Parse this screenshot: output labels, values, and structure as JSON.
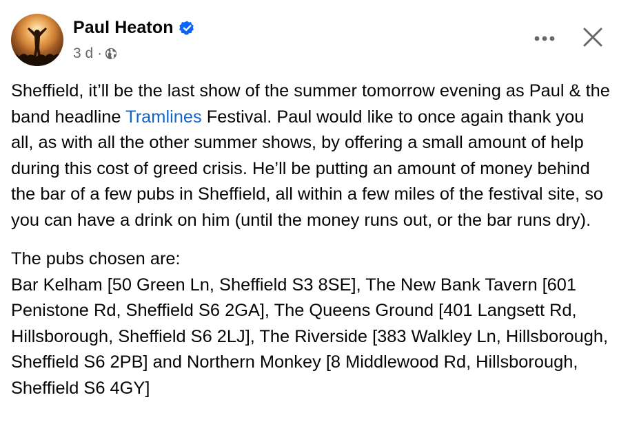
{
  "post": {
    "author": {
      "name": "Paul Heaton",
      "verified": true,
      "avatar_icon": "concert-photo-avatar"
    },
    "timestamp": "3 d",
    "separator": "·",
    "audience_icon": "globe-icon",
    "paragraph1": {
      "before_link": "Sheffield, it’ll be the last show of the summer tomorrow evening as Paul & the band headline ",
      "link": "Tramlines",
      "after_link": " Festival. Paul would like to once again thank you all, as with all the other summer shows, by offering a small amount of help during this cost of greed crisis. He’ll be putting an amount of money behind the bar of a few pubs in Sheffield, all within a few miles of the festival site, so you can have a drink on him (until the money runs out, or the bar runs dry)."
    },
    "paragraph2": {
      "heading": "The pubs chosen are:",
      "text": "Bar Kelham [50 Green Ln, Sheffield S3 8SE], The New Bank Tavern [601 Penistone Rd, Sheffield S6 2GA], The Queens Ground [401 Langsett Rd, Hillsborough, Sheffield S6 2LJ], The Riverside [383 Walkley Ln, Hillsborough, Sheffield S6 2PB] and Northern Monkey [8 Middlewood Rd, Hillsborough, Sheffield S6 4GY]"
    }
  },
  "colors": {
    "text": "#050505",
    "secondary_text": "#65676b",
    "link": "#1465c9",
    "verified": "#0866ff"
  }
}
